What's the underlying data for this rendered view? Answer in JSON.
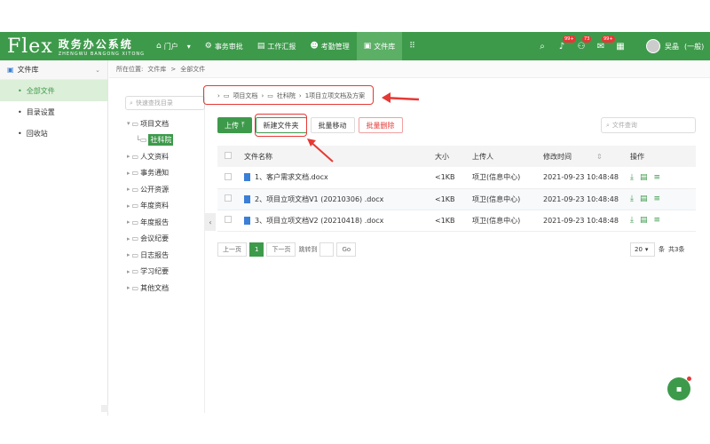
{
  "logo": {
    "flex": "Flex",
    "cn": "政务办公系统",
    "pinyin": "ZHENGWU BANGONG XITONG"
  },
  "nav": [
    {
      "icon": "home-icon",
      "glyph": "⌂",
      "label": "门户",
      "caret": "▾"
    },
    {
      "icon": "org-icon",
      "glyph": "⚙",
      "label": "事务审批"
    },
    {
      "icon": "report-icon",
      "glyph": "▤",
      "label": "工作汇报"
    },
    {
      "icon": "person-icon",
      "glyph": "☻",
      "label": "考勤管理"
    },
    {
      "icon": "file-library-icon",
      "glyph": "▣",
      "label": "文件库"
    },
    {
      "icon": "grid-icon",
      "glyph": "⠿",
      "label": ""
    }
  ],
  "right_icons": [
    {
      "icon": "search-icon",
      "glyph": "⌕",
      "badge": ""
    },
    {
      "icon": "bell-icon",
      "glyph": "♪",
      "badge": "99+"
    },
    {
      "icon": "network-icon",
      "glyph": "⚇",
      "badge": "73"
    },
    {
      "icon": "mail-icon",
      "glyph": "✉",
      "badge": "99+"
    },
    {
      "icon": "book-icon",
      "glyph": "▦",
      "badge": ""
    }
  ],
  "user": {
    "name": "吴晶",
    "role": "(一般)"
  },
  "sidebar": {
    "title": "文件库",
    "items": [
      {
        "label": "全部文件",
        "active": true
      },
      {
        "label": "目录设置"
      },
      {
        "label": "回收站"
      }
    ]
  },
  "breadcrumb": {
    "prefix": "所在位置:",
    "level1": "文件库",
    "level2": "全部文件"
  },
  "tree": {
    "search_placeholder": "快速查找目录",
    "nodes": [
      {
        "label": "项目文档",
        "toggle": "▾"
      },
      {
        "label": "社科院",
        "child": true
      },
      {
        "label": "人文资料",
        "toggle": "▸"
      },
      {
        "label": "事务通知",
        "toggle": "▸"
      },
      {
        "label": "公开资源",
        "toggle": "▸"
      },
      {
        "label": "年度资料",
        "toggle": "▸"
      },
      {
        "label": "年度报告",
        "toggle": "▸"
      },
      {
        "label": "会议纪要",
        "toggle": "▸"
      },
      {
        "label": "日志报告",
        "toggle": "▸"
      },
      {
        "label": "学习纪要",
        "toggle": "▸"
      },
      {
        "label": "其他文档",
        "toggle": "▸"
      }
    ]
  },
  "path": {
    "p1": "项目文档",
    "p2": "社科院",
    "p3": "1项目立项文档及方案"
  },
  "toolbar": {
    "upload": "上传",
    "new_folder": "新建文件夹",
    "batch_move": "批量移动",
    "batch_delete": "批量删除",
    "search_placeholder": "文件查询"
  },
  "table": {
    "headers": {
      "name": "文件名称",
      "size": "大小",
      "uploader": "上传人",
      "modified": "修改时间",
      "ops": "操作"
    },
    "rows": [
      {
        "name": "1、客户需求文档.docx",
        "size": "<1KB",
        "uploader": "项卫(信息中心)",
        "modified": "2021-09-23 10:48:48"
      },
      {
        "name": "2、项目立项文档V1 (20210306) .docx",
        "size": "<1KB",
        "uploader": "项卫(信息中心)",
        "modified": "2021-09-23 10:48:48"
      },
      {
        "name": "3、项目立项文档V2 (20210418) .docx",
        "size": "<1KB",
        "uploader": "项卫(信息中心)",
        "modified": "2021-09-23 10:48:48"
      }
    ]
  },
  "pager": {
    "prev": "上一页",
    "current": "1",
    "next": "下一页",
    "goto": "跳转到",
    "go": "Go",
    "page_size": "20",
    "per": "条",
    "total": "共3条"
  },
  "colors": {
    "brand": "#3e9a4b",
    "annotation": "#e53935"
  }
}
